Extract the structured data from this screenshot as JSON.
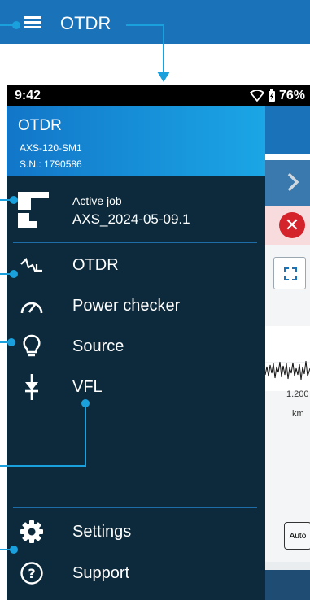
{
  "topbar": {
    "title": "OTDR",
    "menu_icon": "menu-icon"
  },
  "status_bar": {
    "time": "9:42",
    "battery": "76%",
    "icons": [
      "wifi-icon",
      "battery-icon"
    ]
  },
  "drawer": {
    "header": {
      "title": "OTDR",
      "model": "AXS-120-SM1",
      "serial": "S.N.: 1790586"
    },
    "active_job": {
      "label": "Active job",
      "value": "AXS_2024-05-09.1",
      "icon": "active-job-icon"
    },
    "items": [
      {
        "label": "OTDR",
        "icon": "otdr-trace-icon"
      },
      {
        "label": "Power checker",
        "icon": "gauge-icon"
      },
      {
        "label": "Source",
        "icon": "lightbulb-icon"
      },
      {
        "label": "VFL",
        "icon": "vfl-icon"
      }
    ],
    "footer_items": [
      {
        "label": "Settings",
        "icon": "gear-icon"
      },
      {
        "label": "Support",
        "icon": "help-icon"
      }
    ]
  },
  "background_app": {
    "distance_value": "1.200",
    "distance_unit": "km",
    "auto_label": "Auto"
  },
  "colors": {
    "accent": "#1aa0dc",
    "topbar": "#1a72b8",
    "drawer_bg": "#0c2a3c",
    "error": "#d5232c"
  }
}
